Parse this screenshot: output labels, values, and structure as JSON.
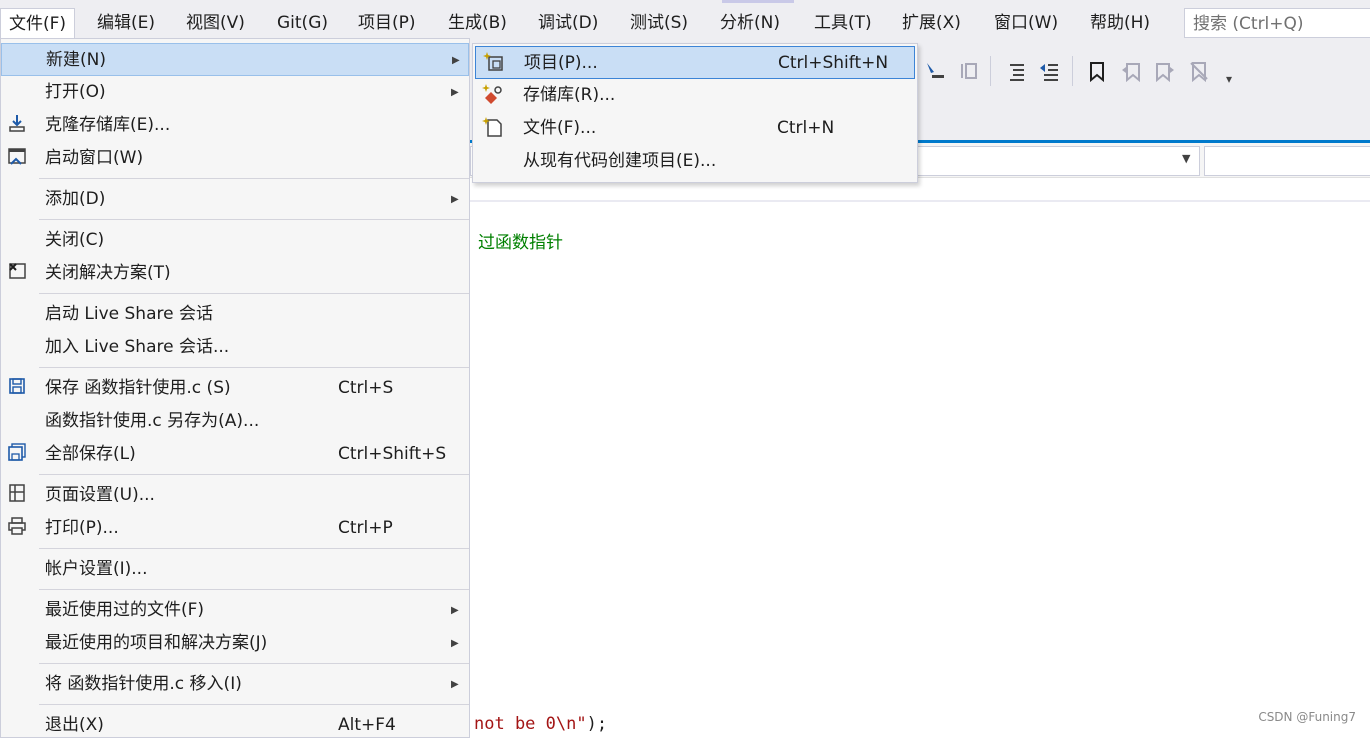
{
  "menubar": {
    "items": [
      {
        "label": "文件(F)"
      },
      {
        "label": "编辑(E)"
      },
      {
        "label": "视图(V)"
      },
      {
        "label": "Git(G)"
      },
      {
        "label": "项目(P)"
      },
      {
        "label": "生成(B)"
      },
      {
        "label": "调试(D)"
      },
      {
        "label": "测试(S)"
      },
      {
        "label": "分析(N)"
      },
      {
        "label": "工具(T)"
      },
      {
        "label": "扩展(X)"
      },
      {
        "label": "窗口(W)"
      },
      {
        "label": "帮助(H)"
      }
    ],
    "search_placeholder": "搜索 (Ctrl+Q)"
  },
  "file_menu": {
    "items": [
      {
        "label": "新建(N)",
        "shortcut": "",
        "submenu": true,
        "icon": ""
      },
      {
        "label": "打开(O)",
        "shortcut": "",
        "submenu": true,
        "icon": ""
      },
      {
        "label": "克隆存储库(E)...",
        "shortcut": "",
        "submenu": false,
        "icon": "clone-icon"
      },
      {
        "label": "启动窗口(W)",
        "shortcut": "",
        "submenu": false,
        "icon": "start-window-icon"
      },
      {
        "label": "添加(D)",
        "shortcut": "",
        "submenu": true,
        "icon": ""
      },
      {
        "label": "关闭(C)",
        "shortcut": "",
        "submenu": false,
        "icon": ""
      },
      {
        "label": "关闭解决方案(T)",
        "shortcut": "",
        "submenu": false,
        "icon": "close-solution-icon"
      },
      {
        "label": "启动 Live Share 会话",
        "shortcut": "",
        "submenu": false,
        "icon": ""
      },
      {
        "label": "加入 Live Share 会话...",
        "shortcut": "",
        "submenu": false,
        "icon": ""
      },
      {
        "label": "保存 函数指针使用.c (S)",
        "shortcut": "Ctrl+S",
        "submenu": false,
        "icon": "save-icon"
      },
      {
        "label": "函数指针使用.c 另存为(A)...",
        "shortcut": "",
        "submenu": false,
        "icon": ""
      },
      {
        "label": "全部保存(L)",
        "shortcut": "Ctrl+Shift+S",
        "submenu": false,
        "icon": "save-all-icon"
      },
      {
        "label": "页面设置(U)...",
        "shortcut": "",
        "submenu": false,
        "icon": "page-setup-icon"
      },
      {
        "label": "打印(P)...",
        "shortcut": "Ctrl+P",
        "submenu": false,
        "icon": "print-icon"
      },
      {
        "label": "帐户设置(I)...",
        "shortcut": "",
        "submenu": false,
        "icon": ""
      },
      {
        "label": "最近使用过的文件(F)",
        "shortcut": "",
        "submenu": true,
        "icon": ""
      },
      {
        "label": "最近使用的项目和解决方案(J)",
        "shortcut": "",
        "submenu": true,
        "icon": ""
      },
      {
        "label": "将 函数指针使用.c 移入(I)",
        "shortcut": "",
        "submenu": true,
        "icon": ""
      },
      {
        "label": "退出(X)",
        "shortcut": "Alt+F4",
        "submenu": false,
        "icon": ""
      }
    ]
  },
  "new_submenu": {
    "items": [
      {
        "label": "项目(P)...",
        "shortcut": "Ctrl+Shift+N",
        "icon": "new-project-icon"
      },
      {
        "label": "存储库(R)...",
        "shortcut": "",
        "icon": "repository-icon"
      },
      {
        "label": "文件(F)...",
        "shortcut": "Ctrl+N",
        "icon": "new-file-icon"
      },
      {
        "label": "从现有代码创建项目(E)...",
        "shortcut": "",
        "icon": ""
      }
    ]
  },
  "editor": {
    "comment_fragment": "过函数指针",
    "code_fragment_string": "not be 0\\n\"",
    "code_fragment_rest": ");"
  },
  "watermark": "CSDN @Funing7",
  "colors": {
    "menubar_bg": "#eeeef2",
    "highlight": "#c9def5",
    "accent": "#007acc",
    "comment": "#008000",
    "string": "#a31515"
  }
}
